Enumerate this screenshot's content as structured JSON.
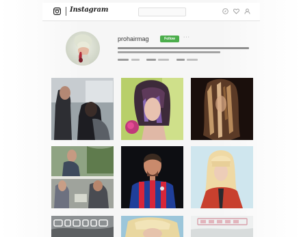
{
  "app": {
    "wordmark": "Instagram"
  },
  "search": {
    "placeholder": ""
  },
  "nav_icons": [
    "compass-icon",
    "heart-icon",
    "profile-icon"
  ],
  "profile": {
    "username": "prohairmag",
    "follow_label": "Follow",
    "more_label": "···",
    "bio": "",
    "stats": {
      "posts": "",
      "followers": "",
      "following": ""
    }
  },
  "colors": {
    "follow_button": "#4cae4c",
    "background": "#f6f6f6",
    "nav_background": "#ffffff"
  },
  "posts": [
    {
      "subject": "salon photo with stylists"
    },
    {
      "subject": "woman with colored bob holding a flower"
    },
    {
      "subject": "model with layered blonde hair, dark background"
    },
    {
      "subject": "group of men in salon"
    },
    {
      "subject": "footballer in red and blue striped kit"
    },
    {
      "subject": "blonde woman with fringe in red jacket"
    },
    {
      "subject": "barbering text graphic"
    },
    {
      "subject": "blonde hair closeup"
    },
    {
      "subject": "text graphic"
    }
  ]
}
